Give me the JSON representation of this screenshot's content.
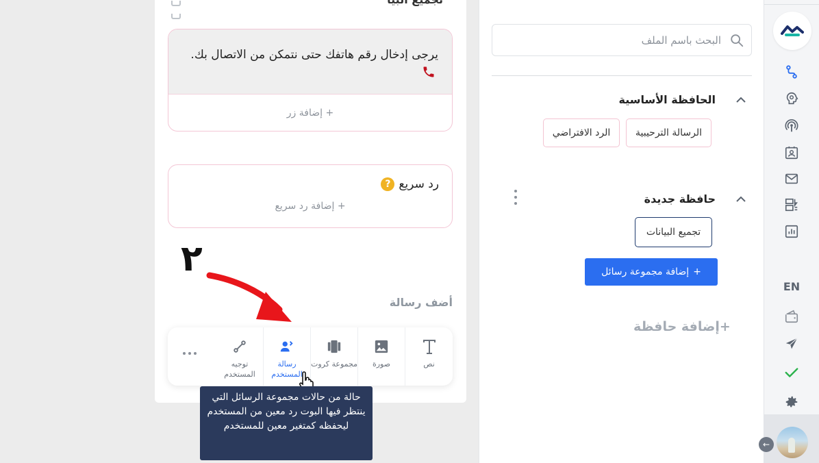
{
  "rail": {
    "lang": "EN",
    "icons": [
      "flow-icon",
      "brain-icon",
      "broadcast-icon",
      "contacts-icon",
      "mail-icon",
      "widgets-icon",
      "stats-icon",
      "wallet-icon",
      "send-icon",
      "check-icon",
      "gear-icon"
    ],
    "active_icon": "flow-icon",
    "check_color": "#2bb24c"
  },
  "panel": {
    "search_placeholder": "البحث باسم الملف",
    "folders": [
      {
        "title": "الحافظة الأساسية",
        "items": [
          "الرسالة الترحيبية",
          "الرد الافتراضي"
        ]
      },
      {
        "title": "حافظة جديدة",
        "items": [
          "تجميع البيانات"
        ]
      }
    ],
    "add_group_label": "إضافة مجموعة رسائل",
    "add_folder_label": "إضافة حافظة"
  },
  "editor": {
    "title": "تجميع البيا",
    "text_card": {
      "message": "يرجى إدخال رقم هاتفك حتى نتمكن من الاتصال بك.",
      "add_button": "+ إضافة زر"
    },
    "quick_reply": {
      "title": "رد سريع",
      "add": "+ إضافة رد سريع"
    },
    "step_number": "٢",
    "add_message_label": "أضف رسالة",
    "tools": [
      {
        "id": "text",
        "label": "نص"
      },
      {
        "id": "image",
        "label": "صورة"
      },
      {
        "id": "cards",
        "label": "مجموعة كروت"
      },
      {
        "id": "user-message",
        "label": "رسالة المستخدم"
      },
      {
        "id": "user-route",
        "label": "توجيه المستخدم"
      }
    ],
    "tooltip": "حالة من حالات مجموعة الرسائل التي ينتظر فيها البوت رد معين من المستخدم ليحفظه كمتغير معين للمستخدم"
  },
  "colors": {
    "primary": "#2b6ef0",
    "tooltip_bg": "#2b3a5c",
    "card_border": "#f3c6d5",
    "arrow": "#e8161b"
  }
}
